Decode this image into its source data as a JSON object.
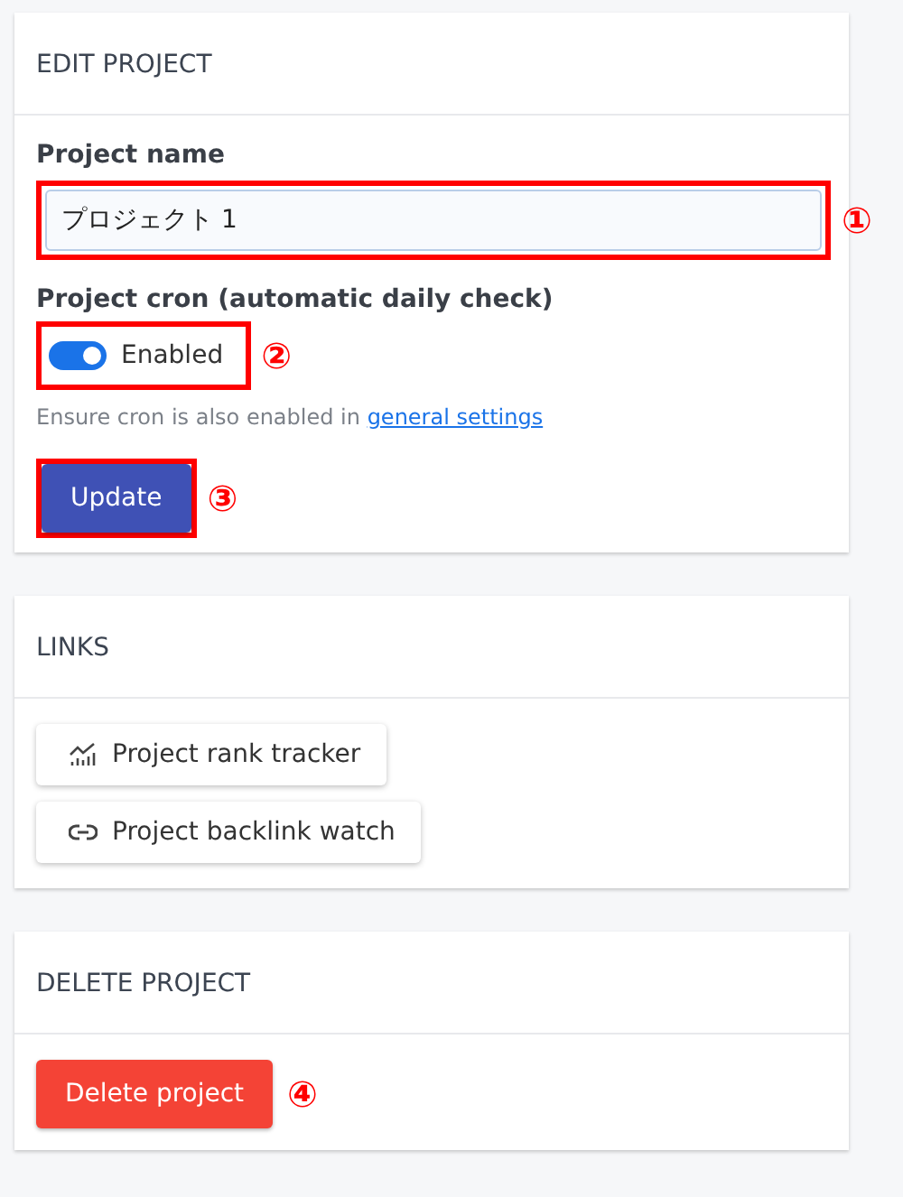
{
  "edit_project": {
    "title": "EDIT PROJECT",
    "name_label": "Project name",
    "name_value": "プロジェクト 1",
    "name_callout": "①",
    "cron_label": "Project cron (automatic daily check)",
    "cron": {
      "on": true,
      "label": "Enabled"
    },
    "cron_callout": "②",
    "hint": {
      "text": "Ensure cron is also enabled in",
      "link": "general settings"
    },
    "update_button": "Update",
    "update_callout": "③"
  },
  "links": {
    "title": "LINKS",
    "items": [
      {
        "kind": "chart",
        "label": "Project rank tracker"
      },
      {
        "kind": "link",
        "label": "Project backlink watch"
      }
    ]
  },
  "delete_project": {
    "title": "DELETE PROJECT",
    "button": "Delete project",
    "callout": "④"
  }
}
